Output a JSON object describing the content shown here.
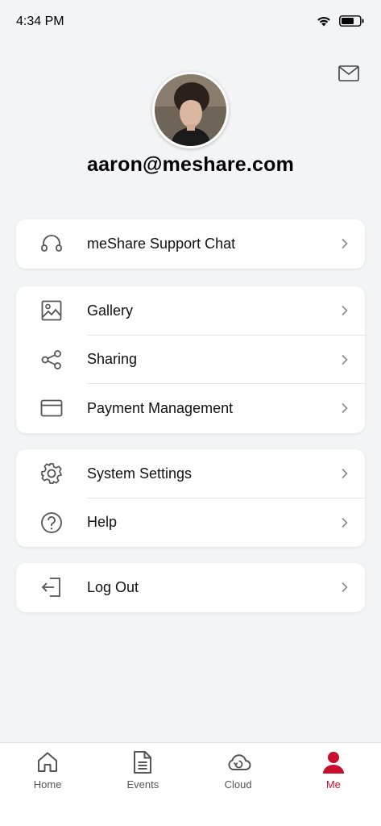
{
  "status_bar": {
    "time": "4:34 PM"
  },
  "profile": {
    "email": "aaron@meshare.com"
  },
  "menu": {
    "support": {
      "label": "meShare Support Chat"
    },
    "gallery": {
      "label": "Gallery"
    },
    "sharing": {
      "label": "Sharing"
    },
    "payment": {
      "label": "Payment Management"
    },
    "settings": {
      "label": "System Settings"
    },
    "help": {
      "label": "Help"
    },
    "logout": {
      "label": "Log Out"
    }
  },
  "tabs": [
    {
      "label": "Home",
      "icon": "home-icon"
    },
    {
      "label": "Events",
      "icon": "document-icon"
    },
    {
      "label": "Cloud",
      "icon": "cloud-icon"
    },
    {
      "label": "Me",
      "icon": "person-icon",
      "active": true
    }
  ],
  "colors": {
    "accent": "#c8102e",
    "background": "#f3f4f6",
    "icon": "#555555"
  }
}
